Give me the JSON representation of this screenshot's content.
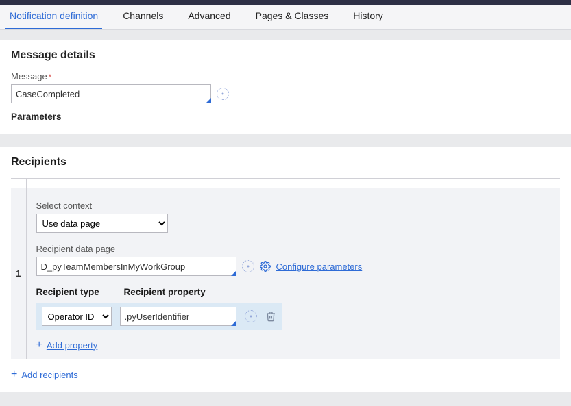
{
  "tabs": {
    "items": [
      {
        "label": "Notification definition",
        "active": true
      },
      {
        "label": "Channels",
        "active": false
      },
      {
        "label": "Advanced",
        "active": false
      },
      {
        "label": "Pages & Classes",
        "active": false
      },
      {
        "label": "History",
        "active": false
      }
    ]
  },
  "message_details": {
    "title": "Message details",
    "message_label": "Message",
    "message_value": "CaseCompleted",
    "parameters_label": "Parameters"
  },
  "recipients": {
    "title": "Recipients",
    "rows": [
      {
        "index": "1",
        "select_context_label": "Select context",
        "select_context_value": "Use data page",
        "recipient_data_page_label": "Recipient data page",
        "recipient_data_page_value": "D_pyTeamMembersInMyWorkGroup",
        "configure_link": "Configure parameters",
        "col_headers": {
          "type": "Recipient type",
          "property": "Recipient property"
        },
        "property_rows": [
          {
            "type": "Operator ID",
            "property": ".pyUserIdentifier"
          }
        ],
        "add_property_label": "Add property"
      }
    ],
    "add_recipients_label": "Add recipients"
  }
}
